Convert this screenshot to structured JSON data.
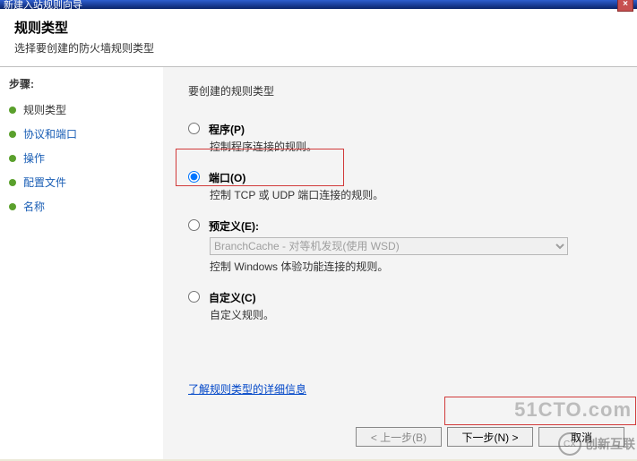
{
  "titlebar": {
    "title": "新建入站规则向导"
  },
  "header": {
    "title": "规则类型",
    "subtitle": "选择要创建的防火墙规则类型"
  },
  "sidebar": {
    "steps_title": "步骤:",
    "items": [
      {
        "label": "规则类型"
      },
      {
        "label": "协议和端口"
      },
      {
        "label": "操作"
      },
      {
        "label": "配置文件"
      },
      {
        "label": "名称"
      }
    ]
  },
  "content": {
    "question": "要创建的规则类型",
    "options": {
      "program": {
        "label": "程序(P)",
        "desc": "控制程序连接的规则。"
      },
      "port": {
        "label": "端口(O)",
        "desc": "控制 TCP 或 UDP 端口连接的规则。"
      },
      "predef": {
        "label": "预定义(E):",
        "select_value": "BranchCache - 对等机发现(使用 WSD)",
        "desc": "控制 Windows 体验功能连接的规则。"
      },
      "custom": {
        "label": "自定义(C)",
        "desc": "自定义规则。"
      }
    },
    "link": "了解规则类型的详细信息"
  },
  "buttons": {
    "back": "< 上一步(B)",
    "next": "下一步(N) >",
    "cancel": "取消"
  },
  "watermark": {
    "w1": "51CTO.com",
    "w2": "创新互联"
  }
}
